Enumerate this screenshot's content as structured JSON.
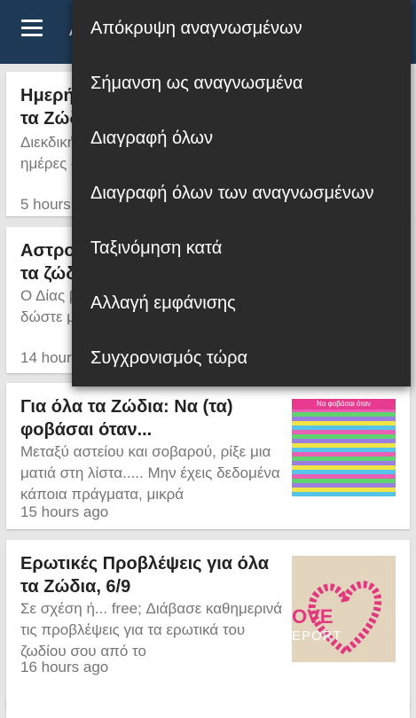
{
  "appbar": {
    "title": "Α"
  },
  "cards": [
    {
      "title": "Ημερήσιες Προβλέψεις για όλα τα Ζώδια",
      "snippet": "Διεκδικήστε τα δικαιώματα σας τις ημέρες αυτές και μην αφήνετε το ζώδιο",
      "time": "5 hours ago"
    },
    {
      "title": "Αστρολογικές Προβλέψεις για τα ζώδια",
      "snippet": "Ο Δίας βρίσκεται στο ζώδιο σας, λοιπόν δώστε μεγαλύτερη σημασία και η ώρα",
      "time": "14 hours ago"
    },
    {
      "title": "Για όλα τα Ζώδια: Να (τα) φοβάσαι όταν...",
      "snippet": "Μεταξύ αστείου και σοβαρού, ρίξε μια ματιά στη λίστα..... Μην έχεις δεδομένα κάποια πράγματα, μικρά",
      "time": "15 hours ago",
      "thumb_caption": "Να φοβάσαι όταν"
    },
    {
      "title": "Ερωτικές Προβλέψεις για όλα τα Ζώδια, 6/9",
      "snippet": "Σε σχέση ή... free; Διάβασε καθημερινά τις προβλέψεις για τα ερωτικά του ζωδίου σου από το",
      "time": "16 hours ago",
      "thumb_word1": "OVE",
      "thumb_word2": "EPORT"
    }
  ],
  "menu": {
    "items": [
      "Απόκρυψη αναγνωσμένων",
      "Σήμανση ως αναγνωσμένα",
      "Διαγραφή όλων",
      "Διαγραφή όλων των αναγνωσμένων",
      "Ταξινόμηση κατά",
      "Αλλαγή εμφάνισης",
      "Συγχρονισμός τώρα"
    ]
  },
  "colors": {
    "appbar": "#1f3a57",
    "menu": "#2b2b2b",
    "background": "#e6e6e6"
  }
}
